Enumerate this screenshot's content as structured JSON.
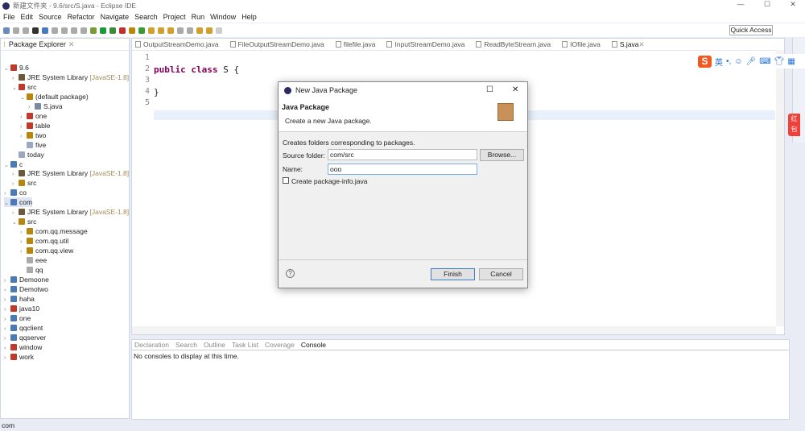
{
  "window": {
    "title": "新建文件夹 - 9.6/src/S.java - Eclipse IDE",
    "min": "—",
    "max": "☐",
    "close": "✕"
  },
  "menu": [
    "File",
    "Edit",
    "Source",
    "Refactor",
    "Navigate",
    "Search",
    "Project",
    "Run",
    "Window",
    "Help"
  ],
  "quick_access": "Quick Access",
  "explorer": {
    "title": "Package Explorer",
    "tree": [
      {
        "d": 0,
        "a": "v",
        "l": "9.6",
        "c": "#c0392b"
      },
      {
        "d": 1,
        "a": ">",
        "l": "JRE System Library",
        "dec": "[JavaSE-1.8]",
        "c": "#6a5a3a"
      },
      {
        "d": 1,
        "a": "v",
        "l": "src",
        "c": "#c0392b"
      },
      {
        "d": 2,
        "a": "v",
        "l": "(default package)",
        "c": "#b8860b"
      },
      {
        "d": 3,
        "a": ">",
        "l": "S.java",
        "c": "#7a8aa0"
      },
      {
        "d": 2,
        "a": ">",
        "l": "one",
        "c": "#c0392b"
      },
      {
        "d": 2,
        "a": ">",
        "l": "table",
        "c": "#c0392b"
      },
      {
        "d": 2,
        "a": ">",
        "l": "two",
        "c": "#b8860b"
      },
      {
        "d": 2,
        "a": "",
        "l": "five",
        "c": "#9aa8c0"
      },
      {
        "d": 1,
        "a": "",
        "l": "today",
        "c": "#9aa8c0"
      },
      {
        "d": 0,
        "a": "v",
        "l": "c",
        "c": "#4a7ab8"
      },
      {
        "d": 1,
        "a": ">",
        "l": "JRE System Library",
        "dec": "[JavaSE-1.8]",
        "c": "#6a5a3a"
      },
      {
        "d": 1,
        "a": ">",
        "l": "src",
        "c": "#b8860b"
      },
      {
        "d": 0,
        "a": ">",
        "l": "co",
        "c": "#4a7ab8"
      },
      {
        "d": 0,
        "a": "v",
        "l": "com",
        "c": "#4a7ab8",
        "sel": true
      },
      {
        "d": 1,
        "a": ">",
        "l": "JRE System Library",
        "dec": "[JavaSE-1.8]",
        "c": "#6a5a3a"
      },
      {
        "d": 1,
        "a": "v",
        "l": "src",
        "c": "#b8860b"
      },
      {
        "d": 2,
        "a": ">",
        "l": "com.qq.message",
        "c": "#b8860b"
      },
      {
        "d": 2,
        "a": ">",
        "l": "com.qq.util",
        "c": "#b8860b"
      },
      {
        "d": 2,
        "a": ">",
        "l": "com.qq.view",
        "c": "#b8860b"
      },
      {
        "d": 2,
        "a": "",
        "l": "eee",
        "c": "#aaa"
      },
      {
        "d": 2,
        "a": "",
        "l": "qq",
        "c": "#aaa"
      },
      {
        "d": 0,
        "a": ">",
        "l": "Demoone",
        "c": "#4a7ab8"
      },
      {
        "d": 0,
        "a": ">",
        "l": "Demotwo",
        "c": "#4a7ab8"
      },
      {
        "d": 0,
        "a": ">",
        "l": "haha",
        "c": "#4a7ab8"
      },
      {
        "d": 0,
        "a": ">",
        "l": "java10",
        "c": "#c0392b"
      },
      {
        "d": 0,
        "a": ">",
        "l": "one",
        "c": "#4a7ab8"
      },
      {
        "d": 0,
        "a": ">",
        "l": "qqclient",
        "c": "#4a7ab8"
      },
      {
        "d": 0,
        "a": ">",
        "l": "qqserver",
        "c": "#4a7ab8"
      },
      {
        "d": 0,
        "a": ">",
        "l": "window",
        "c": "#c0392b"
      },
      {
        "d": 0,
        "a": ">",
        "l": "work",
        "c": "#c0392b"
      }
    ]
  },
  "editor": {
    "tabs": [
      "OutputStreamDemo.java",
      "FileOutputStreamDemo.java",
      "filefile.java",
      "InputStreamDemo.java",
      "ReadByteStream.java",
      "IOfile.java",
      "S.java"
    ],
    "active_tab": 6,
    "lines": [
      "1",
      "2",
      "3",
      "4",
      "5"
    ],
    "kw1": "public class",
    "cls": " S {",
    "brace": "}"
  },
  "console": {
    "tabs": [
      "Declaration",
      "Search",
      "Outline",
      "Task List",
      "Coverage",
      "Console"
    ],
    "message": "No consoles to display at this time."
  },
  "status": "com",
  "ime": {
    "logo": "S",
    "lang": "英",
    "hongbao": "红包"
  },
  "dialog": {
    "title": "New Java Package",
    "heading": "Java Package",
    "subtitle": "Create a new Java package.",
    "desc": "Creates folders corresponding to packages.",
    "source_label": "Source folder:",
    "source_value": "com/src",
    "browse": "Browse...",
    "name_label": "Name:",
    "name_value": "ooo",
    "checkbox_label": "Create package-info.java",
    "checkbox_checked": false,
    "help": "?",
    "finish": "Finish",
    "cancel": "Cancel"
  }
}
